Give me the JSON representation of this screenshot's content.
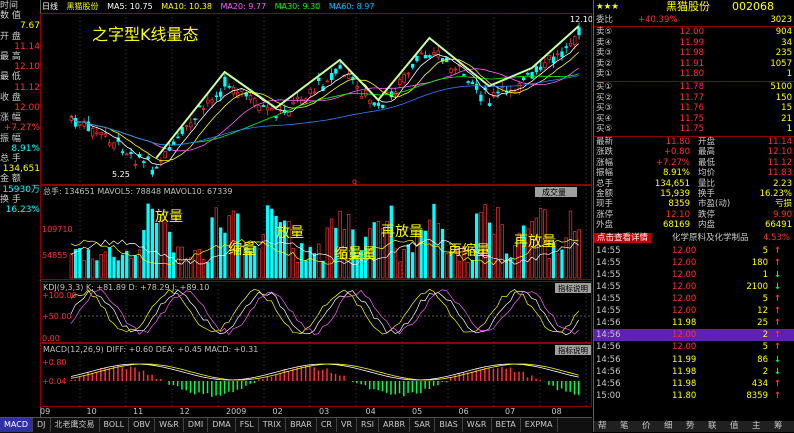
{
  "left_panel": {
    "items": [
      {
        "k": "时间",
        "v": "20090803",
        "c": "l-v"
      },
      {
        "k": "数 值",
        "v": "",
        "c": "l-v"
      },
      {
        "k": "",
        "v": "7.67",
        "c": "l-v"
      },
      {
        "k": "开 盘",
        "v": "",
        "c": "l-v"
      },
      {
        "k": "",
        "v": "11.14",
        "c": "l-red"
      },
      {
        "k": "最 高",
        "v": "",
        "c": "l-v"
      },
      {
        "k": "",
        "v": "12.10",
        "c": "l-red"
      },
      {
        "k": "最 低",
        "v": "",
        "c": "l-v"
      },
      {
        "k": "",
        "v": "11.12",
        "c": "l-red"
      },
      {
        "k": "收 盘",
        "v": "",
        "c": "l-v"
      },
      {
        "k": "",
        "v": "12.00",
        "c": "l-red"
      },
      {
        "k": "涨 幅",
        "v": "",
        "c": "l-v"
      },
      {
        "k": "",
        "v": "+7.27%",
        "c": "l-red"
      },
      {
        "k": "振 幅",
        "v": "",
        "c": "l-v"
      },
      {
        "k": "",
        "v": "8.91%",
        "c": "l-cy"
      },
      {
        "k": "总 手",
        "v": "",
        "c": "l-v"
      },
      {
        "k": "",
        "v": "134,651",
        "c": "l-v"
      },
      {
        "k": "金 额",
        "v": "",
        "c": "l-v"
      },
      {
        "k": "",
        "v": "15930万",
        "c": "l-cy"
      },
      {
        "k": "换 手",
        "v": "",
        "c": "l-v"
      },
      {
        "k": "",
        "v": "16.23%",
        "c": "l-cy"
      }
    ]
  },
  "top_bar": {
    "tag": "日线",
    "name": "黑猫股份",
    "ma5": "MA5: 10.75",
    "ma10": "MA10: 10.38",
    "ma20": "MA20: 9.77",
    "ma30": "MA30: 9.30",
    "ma60": "MA60: 8.97"
  },
  "chart_text": {
    "title": "之字型K线量态",
    "high_label": "12.10",
    "low_label": "5.25",
    "vol_header": "总手: 134651  MAVOL5: 78848  MAVOL10: 67339",
    "vol_btn": "成交量",
    "vol_ticks": [
      "109710",
      "54855"
    ],
    "vol_annotations": [
      "放量",
      "缩量",
      "放量",
      "缩量量",
      "再放量",
      "再缩量",
      "再放量"
    ],
    "kdj_header": "KDJ(9,3,3)  K: +81.89  D: +78.29  J: +89.10",
    "kdj_btn": "指标说明",
    "kdj_ticks": [
      "+100.00",
      "+50.00",
      "0.00"
    ],
    "macd_header": "MACD(12,26,9)  DIFF: +0.60  DEA: +0.45  MACD: +0.31",
    "macd_btn": "指标说明",
    "macd_ticks": [
      "+0.80",
      "+0.04"
    ],
    "x_labels": [
      "09",
      "10",
      "11",
      "12",
      "2009",
      "02",
      "03",
      "04",
      "05",
      "06",
      "07",
      "08"
    ]
  },
  "bottom_tabs": [
    "MACD",
    "DJ",
    "北老鹰交易",
    "BOLL",
    "OBV",
    "W&R",
    "DMI",
    "DMA",
    "FSL",
    "TRIX",
    "BRAR",
    "CR",
    "VR",
    "RSI",
    "ARBR",
    "SAR",
    "BIAS",
    "W&R",
    "BETA",
    "EXPMA"
  ],
  "right_panel": {
    "stars": "★★★",
    "name": "黑猫股份",
    "code": "002068",
    "weibi": {
      "label": "委比",
      "pct": "+40.39%",
      "num": "3023"
    },
    "sell": [
      {
        "l": "卖⑤",
        "p": "12.00",
        "v": "904"
      },
      {
        "l": "卖④",
        "p": "11.99",
        "v": "34"
      },
      {
        "l": "卖③",
        "p": "11.98",
        "v": "235"
      },
      {
        "l": "卖②",
        "p": "11.91",
        "v": "1057"
      },
      {
        "l": "卖①",
        "p": "11.80",
        "v": "1"
      }
    ],
    "buy": [
      {
        "l": "买①",
        "p": "11.78",
        "v": "5100"
      },
      {
        "l": "买②",
        "p": "11.77",
        "v": "150"
      },
      {
        "l": "买③",
        "p": "11.76",
        "v": "15"
      },
      {
        "l": "买④",
        "p": "11.75",
        "v": "21"
      },
      {
        "l": "买⑤",
        "p": "11.75",
        "v": "1"
      }
    ],
    "stats": [
      {
        "a": "最新",
        "av": "11.80",
        "b": "开盘",
        "bv": "11.14"
      },
      {
        "a": "涨跌",
        "av": "+0.80",
        "b": "最高",
        "bv": "12.10"
      },
      {
        "a": "涨幅",
        "av": "+7.27%",
        "b": "最低",
        "bv": "11.12"
      },
      {
        "a": "振幅",
        "av": "8.91%",
        "b": "均价",
        "bv": "11.83"
      },
      {
        "a": "总手",
        "av": "134,651",
        "b": "量比",
        "bv": "2.23"
      },
      {
        "a": "金额",
        "av": "15,939",
        "b": "换手",
        "bv": "16.23%"
      },
      {
        "a": "现手",
        "av": "8359",
        "b": "市盈(动)",
        "bv": "亏损"
      },
      {
        "a": "涨停",
        "av": "12.10",
        "b": "跌停",
        "bv": "9.90"
      },
      {
        "a": "外盘",
        "av": "68169",
        "b": "内盘",
        "bv": "66491"
      }
    ],
    "news_btn": "点击查看详情",
    "sector": "化学原料及化学制品",
    "sector_pct": "4.53%",
    "ticks": [
      {
        "t": "14:55",
        "p": "12.00",
        "v": "5",
        "d": "up"
      },
      {
        "t": "14:55",
        "p": "12.00",
        "v": "180",
        "d": "up"
      },
      {
        "t": "14:55",
        "p": "12.00",
        "v": "1",
        "d": "down"
      },
      {
        "t": "14:55",
        "p": "12.00",
        "v": "2100",
        "d": "down"
      },
      {
        "t": "14:55",
        "p": "12.00",
        "v": "5",
        "d": "up"
      },
      {
        "t": "14:55",
        "p": "12.00",
        "v": "12",
        "d": "up"
      },
      {
        "t": "14:56",
        "p": "11.98",
        "v": "25",
        "d": "up"
      },
      {
        "t": "14:56",
        "p": "12.00",
        "v": "2",
        "d": "up"
      },
      {
        "t": "14:56",
        "p": "12.00",
        "v": "5",
        "d": "up"
      },
      {
        "t": "14:56",
        "p": "11.99",
        "v": "86",
        "d": "down"
      },
      {
        "t": "14:56",
        "p": "11.98",
        "v": "2",
        "d": "down"
      },
      {
        "t": "14:56",
        "p": "11.98",
        "v": "434",
        "d": "up"
      },
      {
        "t": "15:00",
        "p": "11.80",
        "v": "8359",
        "d": "up"
      }
    ],
    "footer": [
      "帮",
      "笔",
      "价",
      "细",
      "势",
      "联",
      "值",
      "主",
      "筹"
    ]
  },
  "colors": {
    "up": "#ff3030",
    "down": "#00ff40",
    "yellow": "#ffff00",
    "cyan": "#00ffff"
  }
}
